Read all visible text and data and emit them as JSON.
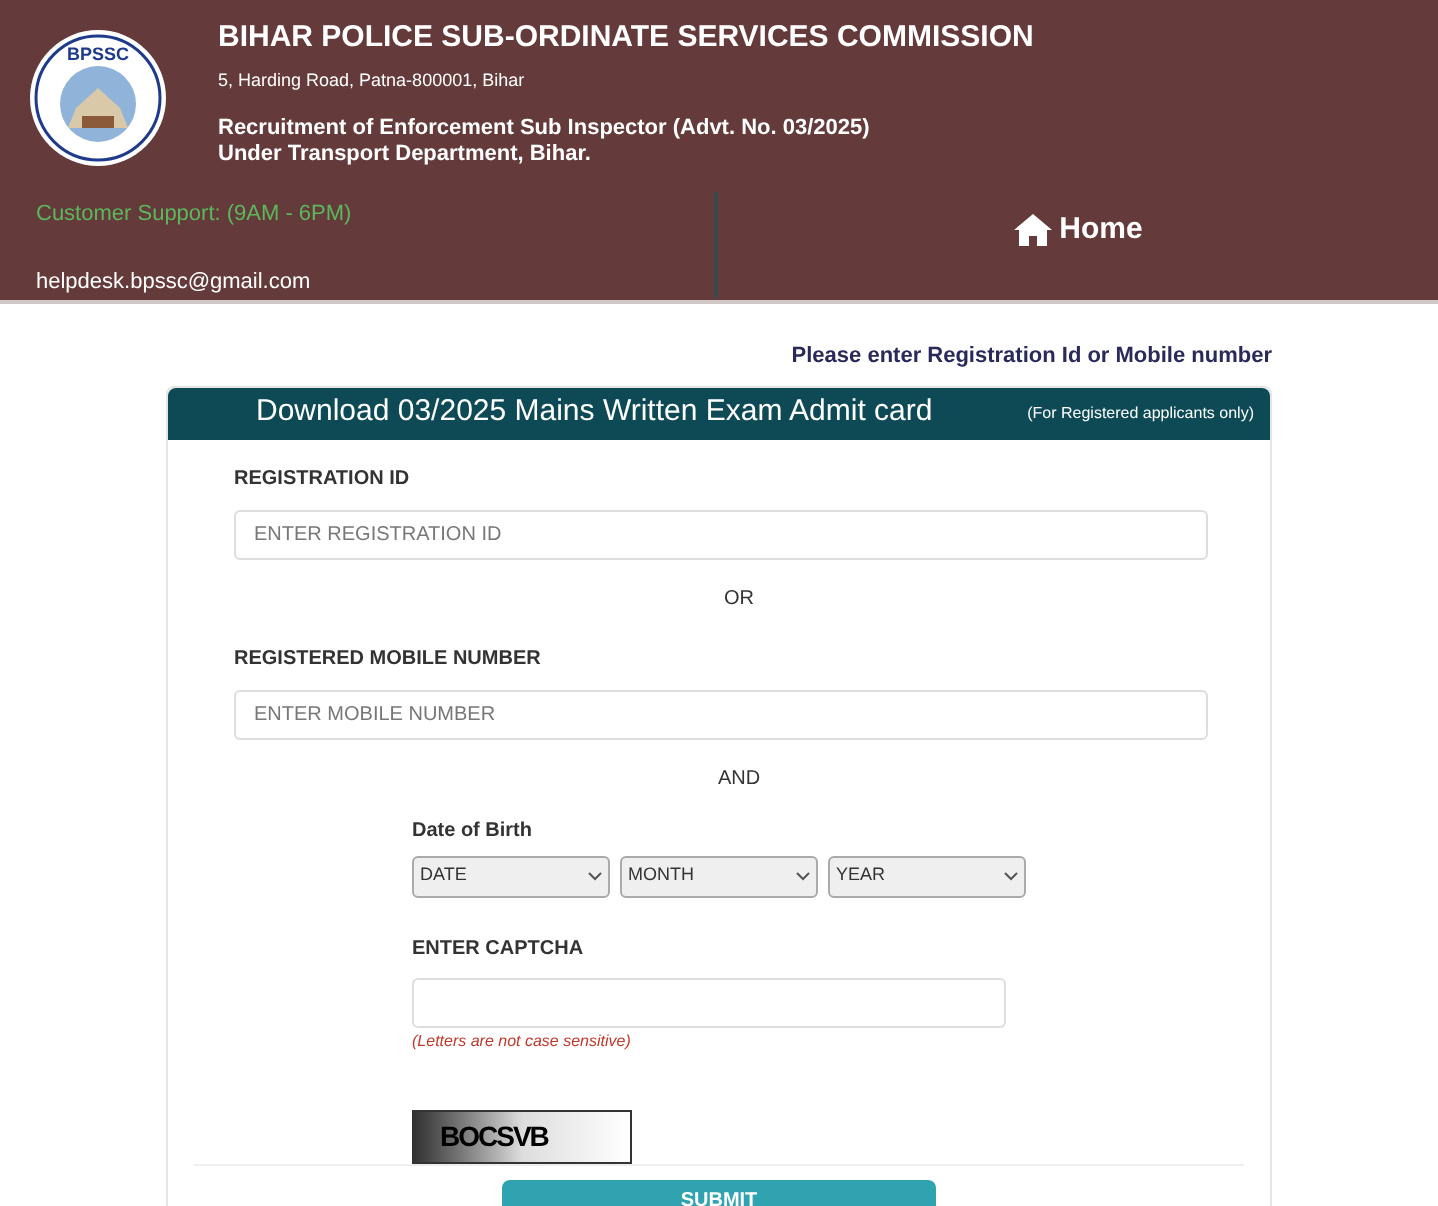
{
  "header": {
    "logo_text": "BPSSC",
    "title": "BIHAR POLICE SUB-ORDINATE SERVICES COMMISSION",
    "address": "5, Harding Road, Patna-800001, Bihar",
    "recruitment_lines": [
      "Recruitment of Enforcement Sub Inspector (Advt. No. 03/2025)",
      "Under Transport Department, Bihar."
    ],
    "support": "Customer Support: (9AM - 6PM)",
    "email": "helpdesk.bpssc@gmail.com",
    "home_link": "Home"
  },
  "notice": "Please enter Registration Id or Mobile number",
  "card": {
    "title": "Download 03/2025 Mains Written Exam Admit card",
    "subtitle": "(For Registered applicants only)",
    "registration": {
      "label": "REGISTRATION ID",
      "placeholder": "ENTER REGISTRATION ID"
    },
    "or": "OR",
    "mobile": {
      "label": "REGISTERED MOBILE NUMBER",
      "placeholder": "ENTER MOBILE NUMBER"
    },
    "and": "AND",
    "dob": {
      "label": "Date of Birth",
      "selects": [
        "DATE",
        "MONTH",
        "YEAR"
      ]
    },
    "captcha": {
      "label": "ENTER CAPTCHA",
      "hint": "(Letters are not case sensitive)",
      "code": "BOCSVB"
    },
    "submit": "SUBMIT"
  }
}
